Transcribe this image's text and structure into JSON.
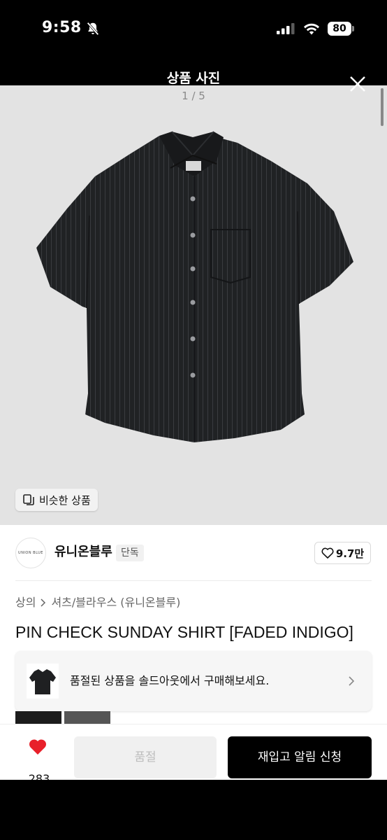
{
  "status_bar": {
    "time": "9:58",
    "battery": "80",
    "icons": [
      "bell-off-icon",
      "signal-icon",
      "wifi-icon",
      "battery-icon"
    ]
  },
  "viewer": {
    "title": "상품 사진",
    "counter": "1 / 5",
    "close_icon": "close-icon",
    "similar_label": "비슷한 상품",
    "similar_icon": "copy-icon"
  },
  "shop": {
    "name": "유니온블루",
    "tag": "단독",
    "logo_text": "UNION BLUE",
    "likes": "9.7만"
  },
  "product": {
    "breadcrumb": [
      "상의",
      "셔츠/블라우스 (유니온블루)"
    ],
    "title": "PIN CHECK SUNDAY SHIRT [FADED INDIGO]"
  },
  "soldout_banner": {
    "text": "품절된 상품을 솔드아웃에서 구매해보세요."
  },
  "actions": {
    "wish_count": "283",
    "soldout_label": "품절",
    "restock_label": "재입고 알림 신청"
  },
  "colors": {
    "heart": "#e8202a",
    "primary_button": "#000000",
    "photo_bg": "#e3e3e3"
  }
}
